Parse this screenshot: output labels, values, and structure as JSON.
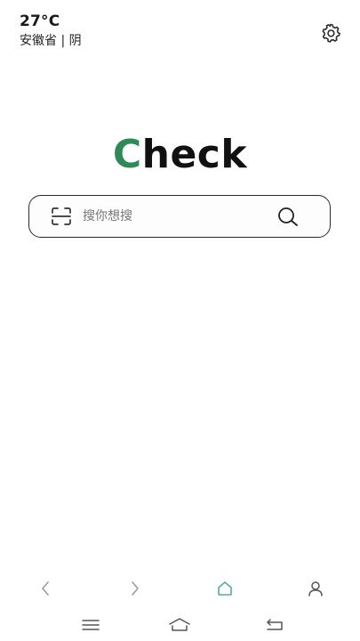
{
  "weather": {
    "temperature": "27°C",
    "location": "安徽省 | 阴"
  },
  "logo": {
    "first_letter": "C",
    "rest": "heck",
    "accent_color": "#2e8b57"
  },
  "search": {
    "placeholder": "搜你想搜"
  },
  "icons": {
    "settings": "gear-icon",
    "scan": "scan-icon",
    "search": "search-icon",
    "back": "chevron-left-icon",
    "forward": "chevron-right-icon",
    "home": "home-icon",
    "profile": "user-icon",
    "menu": "menu-icon",
    "system_home": "system-home-icon",
    "system_back": "system-back-icon"
  },
  "colors": {
    "home_active": "#5aa9a0",
    "nav_inactive": "#9a9a9a"
  }
}
